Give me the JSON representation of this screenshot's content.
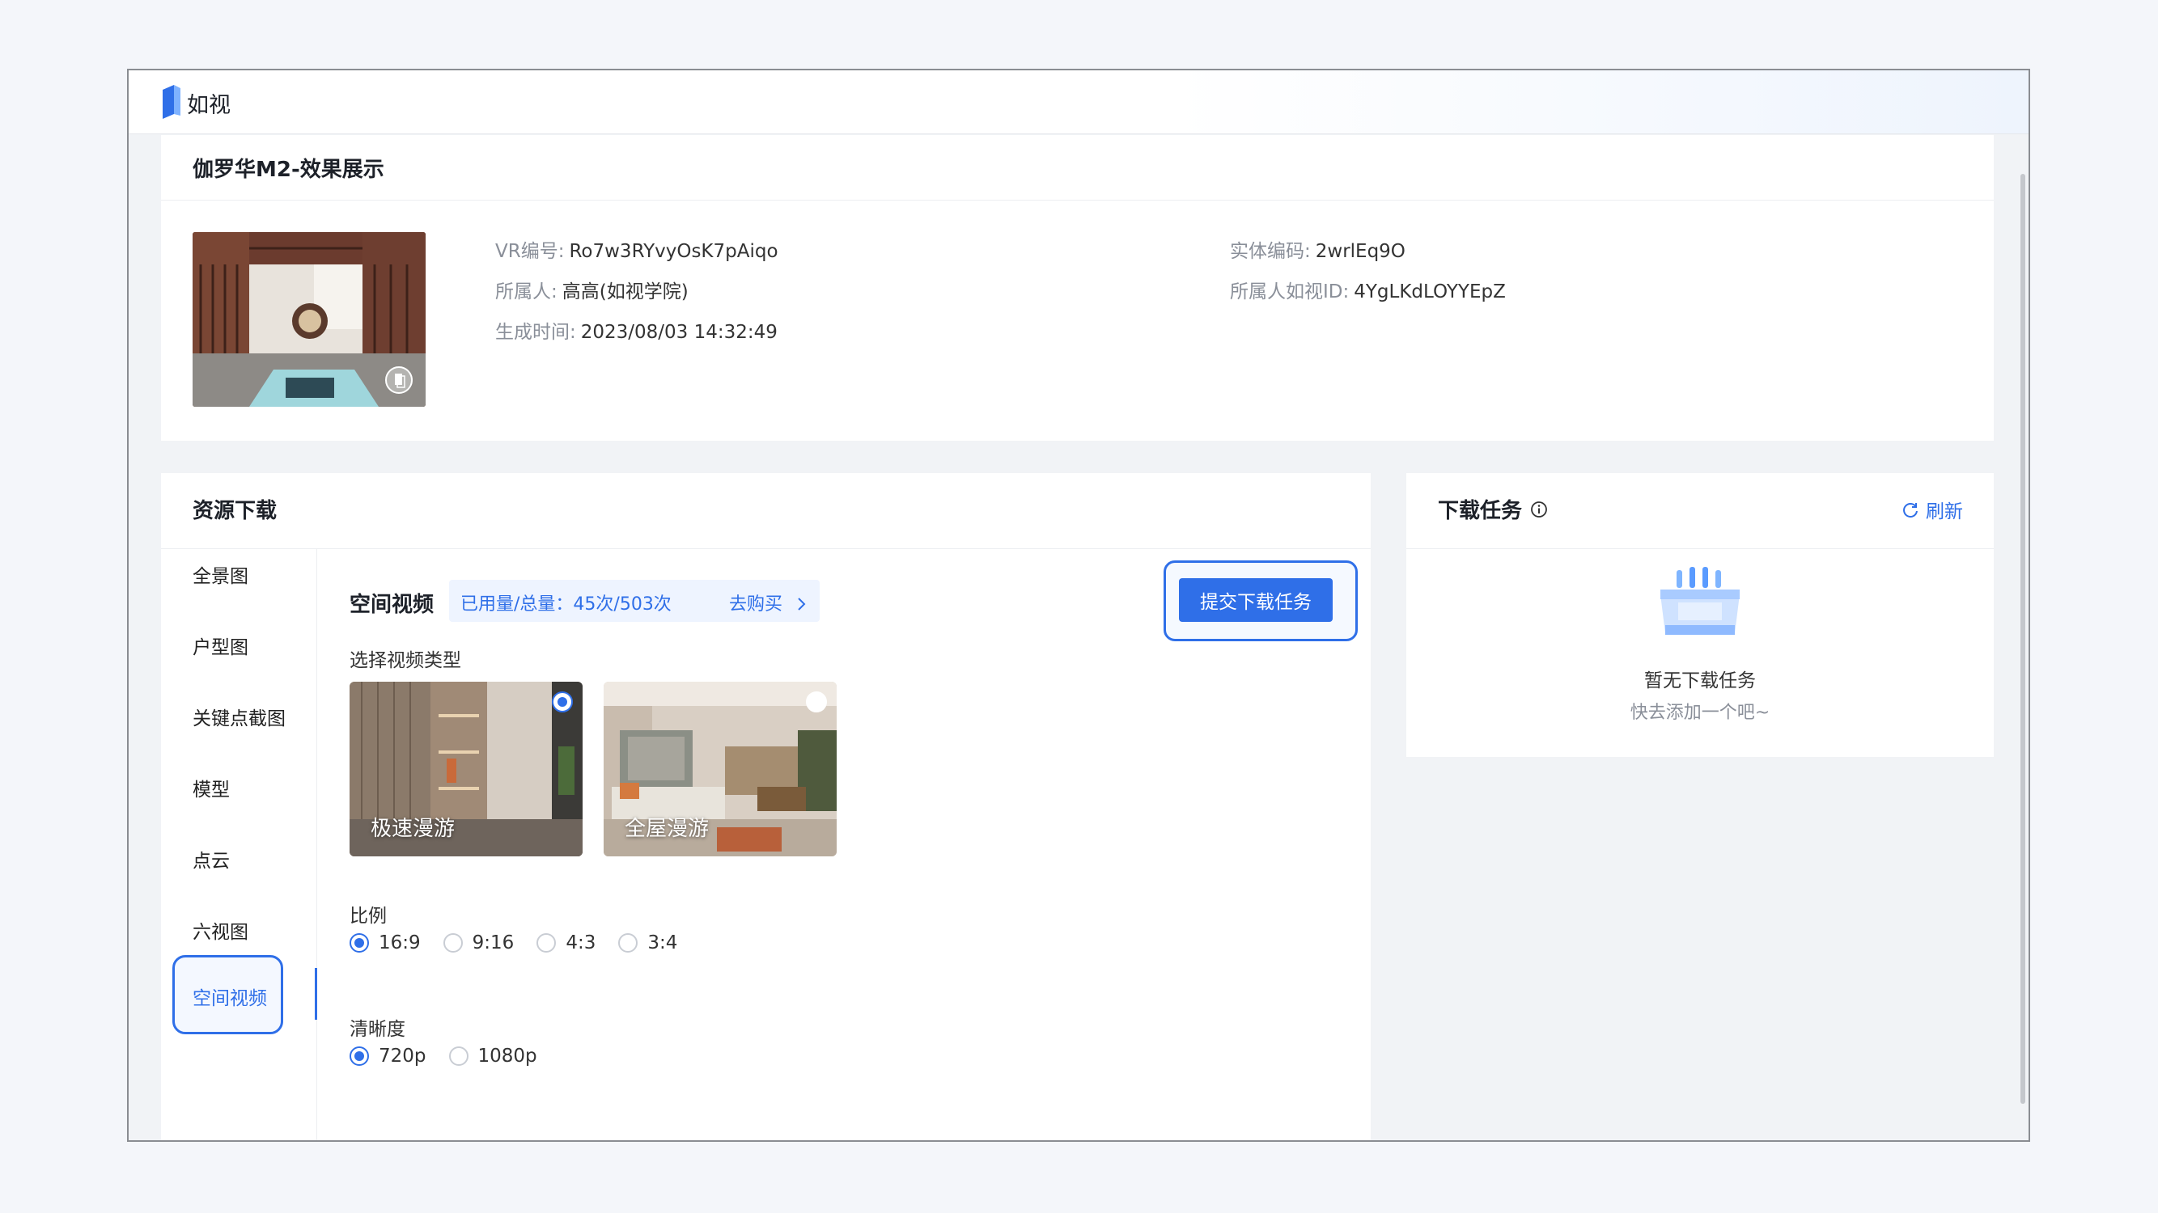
{
  "app": {
    "name": "如视"
  },
  "scene": {
    "title": "伽罗华M2-效果展示",
    "vr_id_label": "VR编号:",
    "vr_id": "Ro7w3RYvyOsK7pAiqo",
    "owner_label": "所属人:",
    "owner": "高高(如视学院)",
    "created_label": "生成时间:",
    "created": "2023/08/03 14:32:49",
    "entity_code_label": "实体编码:",
    "entity_code": "2wrlEq9O",
    "owner_id_label": "所属人如视ID:",
    "owner_id": "4YgLKdLOYYEpZ"
  },
  "resources": {
    "title": "资源下载",
    "sidebar": [
      "全景图",
      "户型图",
      "关键点截图",
      "模型",
      "点云",
      "六视图",
      "空间视频"
    ],
    "active_item": "空间视频",
    "section_title": "空间视频",
    "usage": "已用量/总量：45次/503次",
    "buy_label": "去购买",
    "submit_label": "提交下载任务",
    "video_type_label": "选择视频类型",
    "video_types": [
      {
        "label": "极速漫游",
        "selected": true
      },
      {
        "label": "全屋漫游",
        "selected": false
      }
    ],
    "ratio_label": "比例",
    "ratios": [
      "16:9",
      "9:16",
      "4:3",
      "3:4"
    ],
    "ratio_selected": "16:9",
    "resolution_label": "清晰度",
    "resolutions": [
      "720p",
      "1080p"
    ],
    "resolution_selected": "720p"
  },
  "tasks": {
    "title": "下载任务",
    "refresh_label": "刷新",
    "empty_title": "暂无下载任务",
    "empty_sub": "快去添加一个吧~"
  },
  "colors": {
    "accent": "#2f6fe8",
    "page_bg": "#f1f3f6"
  },
  "icons": [
    "logo-icon",
    "info-icon",
    "refresh-icon",
    "chevron-right-icon",
    "copy-icon",
    "empty-box-illustration"
  ]
}
